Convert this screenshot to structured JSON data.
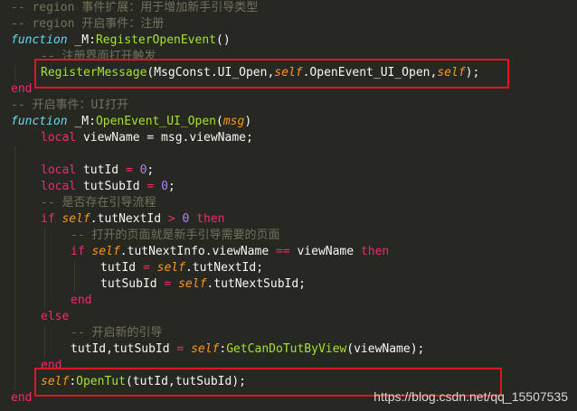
{
  "code": {
    "l1": "-- region 事件扩展：用于增加新手引导类型",
    "l2": "-- region 开启事件：注册",
    "l3_kw": "function",
    "l3_name": " _M:",
    "l3_fn": "RegisterOpenEvent",
    "l3_rest": "()",
    "l4": "-- 注册界面打开触发",
    "l5_fn": "RegisterMessage",
    "l5_a": "(MsgConst.UI_Open,",
    "l5_self1": "self",
    "l5_b": ".OpenEvent_UI_Open,",
    "l5_self2": "self",
    "l5_c": ");",
    "l6": "end",
    "l7": "-- 开启事件：UI打开",
    "l8_kw": "function",
    "l8_name": " _M:",
    "l8_fn": "OpenEvent_UI_Open",
    "l8_p1": "(",
    "l8_param": "msg",
    "l8_p2": ")",
    "l9_kw": "local",
    "l9_rest": " viewName = msg.viewName;",
    "l11_kw": "local",
    "l11_a": " tutId ",
    "l11_eq": "=",
    "l11_sp": " ",
    "l11_num": "0",
    "l11_b": ";",
    "l12_kw": "local",
    "l12_a": " tutSubId ",
    "l12_eq": "=",
    "l12_sp": " ",
    "l12_num": "0",
    "l12_b": ";",
    "l13": "-- 是否存在引导流程",
    "l14_if": "if",
    "l14_sp": " ",
    "l14_self": "self",
    "l14_a": ".tutNextId ",
    "l14_gt": ">",
    "l14_sp2": " ",
    "l14_num": "0",
    "l14_then": " then",
    "l15": "-- 打开的页面就是新手引导需要的页面",
    "l16_if": "if",
    "l16_sp": " ",
    "l16_self": "self",
    "l16_a": ".tutNextInfo.viewName ",
    "l16_eq": "==",
    "l16_b": " viewName ",
    "l16_then": "then",
    "l17_a": "tutId ",
    "l17_eq": "=",
    "l17_sp": " ",
    "l17_self": "self",
    "l17_b": ".tutNextId;",
    "l18_a": "tutSubId ",
    "l18_eq": "=",
    "l18_sp": " ",
    "l18_self": "self",
    "l18_b": ".tutNextSubId;",
    "l19": "end",
    "l20": "else",
    "l21": "-- 开启新的引导",
    "l22_a": "tutId,tutSubId ",
    "l22_eq": "=",
    "l22_sp": " ",
    "l22_self": "self",
    "l22_colon": ":",
    "l22_fn": "GetCanDoTutByView",
    "l22_b": "(viewName);",
    "l23": "end",
    "l24_self": "self",
    "l24_colon": ":",
    "l24_fn": "OpenTut",
    "l24_b": "(tutId,tutSubId);",
    "l25": "end"
  },
  "watermark": "https://blog.csdn.net/qq_15507535",
  "colors": {
    "background": "#272822",
    "highlight_box": "#e0151f"
  }
}
